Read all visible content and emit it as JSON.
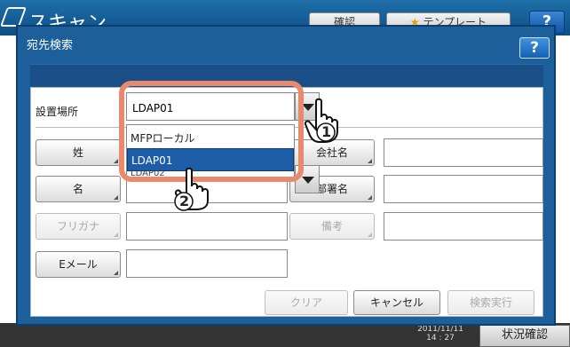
{
  "background": {
    "title": "スキャン",
    "confirm_label": "確認",
    "template_label": "テンプレート",
    "help_label": "?",
    "datetime": "2011/11/11\n14 : 27",
    "status_label": "状況確認"
  },
  "dialog": {
    "title": "宛先検索",
    "help_label": "?",
    "location_label": "設置場所",
    "location_value": "LDAP01",
    "dropdown_options": [
      "MFPローカル",
      "LDAP01",
      "LDAP02"
    ],
    "fields": {
      "surname": "姓",
      "given_name": "名",
      "furigana": "フリガナ",
      "email": "Eメール",
      "company": "会社名",
      "department": "部署名",
      "note": "備考"
    },
    "actions": {
      "clear": "クリア",
      "cancel": "キャンセル",
      "search": "検索実行"
    },
    "steps": [
      "1",
      "2"
    ]
  }
}
